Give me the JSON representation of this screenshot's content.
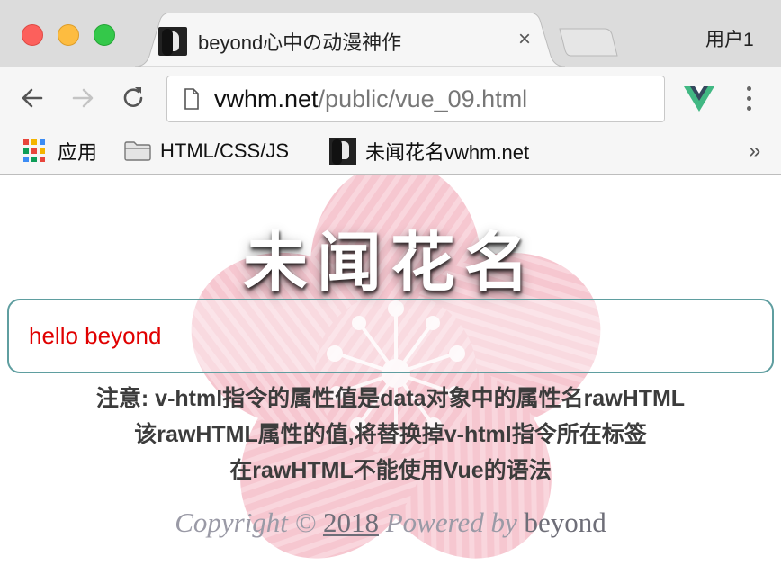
{
  "window": {
    "tab_title": "beyond心中の动漫神作",
    "tab_close": "×",
    "profile_label": "用户1"
  },
  "toolbar": {
    "url_domain": "vwhm.net",
    "url_path": "/public/vue_09.html",
    "icons": [
      "back-arrow-icon",
      "forward-arrow-icon",
      "reload-icon",
      "page-icon",
      "vue-devtools-icon",
      "menu-icon"
    ]
  },
  "bookmarks": {
    "items": [
      {
        "label": "应用",
        "icon": "apps-grid-icon"
      },
      {
        "label": "HTML/CSS/JS",
        "icon": "folder-icon"
      },
      {
        "label": "未闻花名vwhm.net",
        "icon": "site-favicon-icon"
      }
    ],
    "more_label": "»"
  },
  "page": {
    "heading": "未闻花名",
    "message": "hello beyond",
    "notes": [
      "注意: v-html指令的属性值是data对象中的属性名rawHTML",
      "该rawHTML属性的值,将替换掉v-html指令所在标签",
      "在rawHTML不能使用Vue的语法"
    ],
    "footer": {
      "copyright": "Copyright ©",
      "year": "2018",
      "powered": "Powered by",
      "author": "beyond"
    }
  },
  "colors": {
    "accent_border": "#5f9ea0",
    "message_text": "#e00000",
    "background_flower": "#f7c6d0"
  }
}
